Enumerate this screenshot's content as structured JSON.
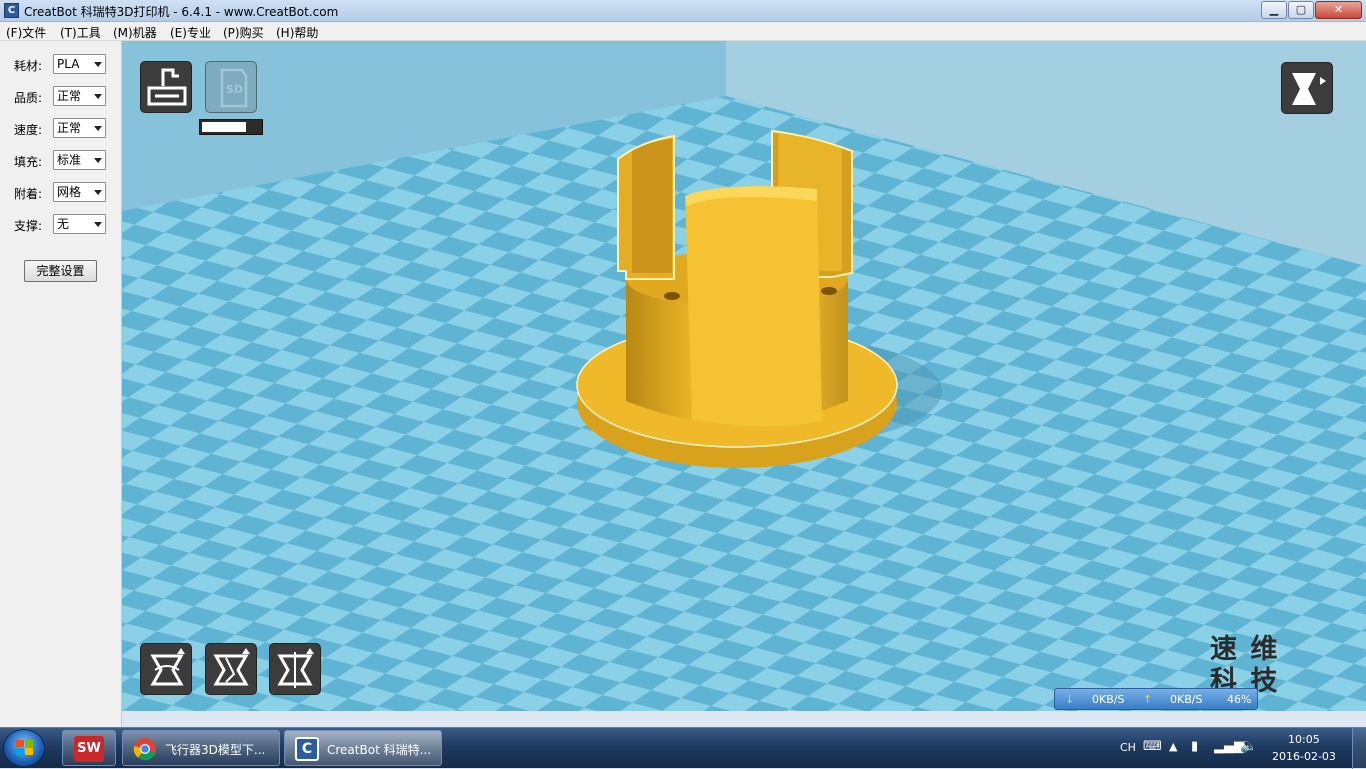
{
  "window": {
    "title": "CreatBot 科瑞特3D打印机 - 6.4.1 - www.CreatBot.com",
    "icon_letter": "C",
    "minimize_glyph": "▁",
    "maximize_glyph": "▢",
    "close_glyph": "✕"
  },
  "menu": [
    "(F)文件",
    "(T)工具",
    "(M)机器",
    "(E)专业",
    "(P)购买",
    "(H)帮助"
  ],
  "settings": [
    {
      "label": "耗材:",
      "value": "PLA"
    },
    {
      "label": "品质:",
      "value": "正常"
    },
    {
      "label": "速度:",
      "value": "正常"
    },
    {
      "label": "填充:",
      "value": "标准"
    },
    {
      "label": "附着:",
      "value": "网格"
    },
    {
      "label": "支撑:",
      "value": "无"
    }
  ],
  "full_settings_label": "完整设置",
  "viewport": {
    "sd_label": "SD",
    "load_progress": 0.75,
    "watermark_line1": "速 维",
    "watermark_line2": "科 技",
    "model_color": "#f2bd2a",
    "floor_color_light": "#8ad0e6",
    "floor_color_dark": "#5fb3d3",
    "icons": [
      "load-model-icon",
      "save-sd-icon",
      "view-mode-icon",
      "rotate-icon",
      "scale-icon",
      "mirror-icon"
    ]
  },
  "network": {
    "down": "0KB/S",
    "up": "0KB/S",
    "percent": "46%"
  },
  "taskbar": {
    "items": [
      {
        "label": "飞行器3D模型下...",
        "icon": "chrome-icon"
      },
      {
        "label": "CreatBot 科瑞特...",
        "icon": "creatbot-icon"
      }
    ],
    "solidworks_label": "SW",
    "lang": "CH",
    "time": "10:05",
    "date": "2016-02-03"
  }
}
